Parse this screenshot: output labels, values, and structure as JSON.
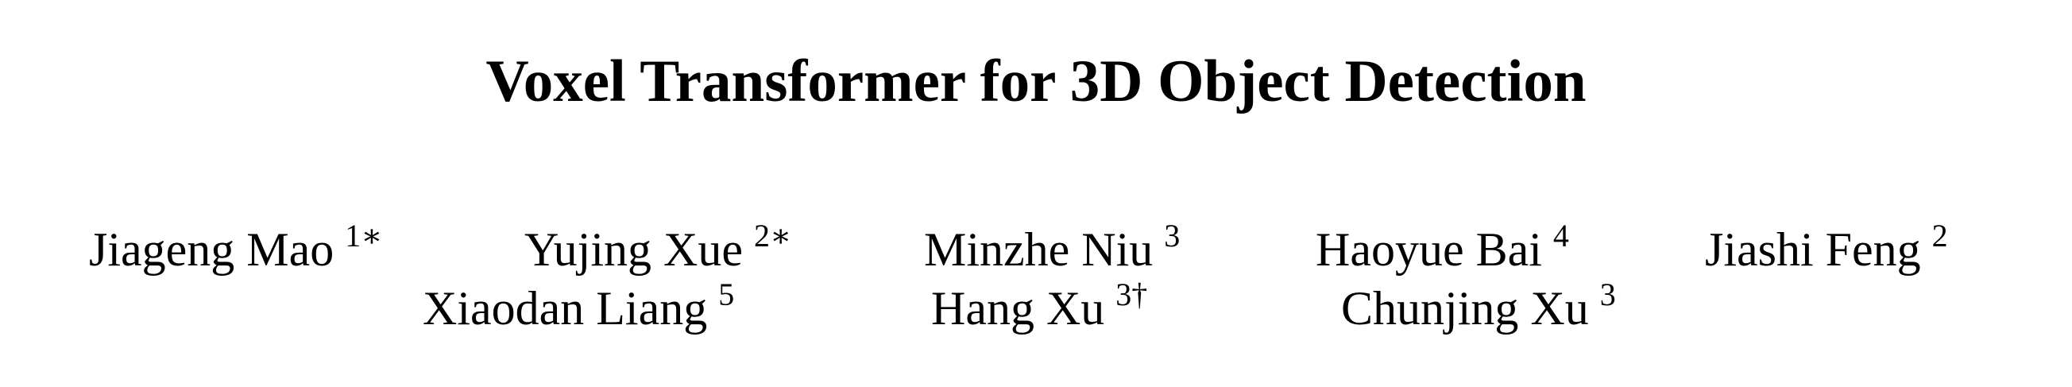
{
  "paper": {
    "title": "Voxel Transformer for 3D Object Detection",
    "authors": [
      {
        "name": "Jiageng Mao",
        "affiliation": "1∗"
      },
      {
        "name": "Yujing Xue",
        "affiliation": "2∗"
      },
      {
        "name": "Minzhe Niu",
        "affiliation": "3"
      },
      {
        "name": "Haoyue Bai",
        "affiliation": "4"
      },
      {
        "name": "Jiashi Feng",
        "affiliation": "2"
      },
      {
        "name": "Xiaodan Liang",
        "affiliation": "5"
      },
      {
        "name": "Hang Xu",
        "affiliation": "3†"
      },
      {
        "name": "Chunjing Xu",
        "affiliation": "3"
      }
    ]
  }
}
